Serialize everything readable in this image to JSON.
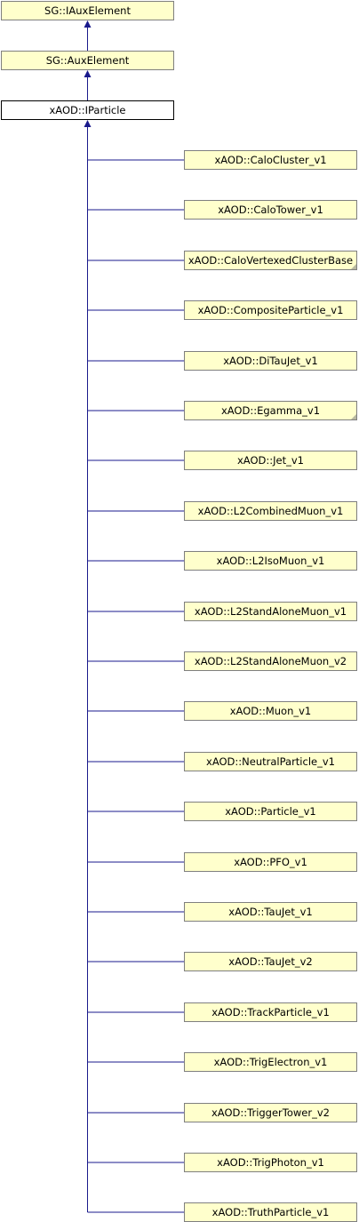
{
  "diagram": {
    "base_chain": [
      {
        "label": "SG::IAuxElement",
        "current": false
      },
      {
        "label": "SG::AuxElement",
        "current": false
      },
      {
        "label": "xAOD::IParticle",
        "current": true
      }
    ],
    "derived": [
      {
        "label": "xAOD::CaloCluster_v1",
        "folded": false
      },
      {
        "label": "xAOD::CaloTower_v1",
        "folded": false
      },
      {
        "label": "xAOD::CaloVertexedClusterBase",
        "folded": true
      },
      {
        "label": "xAOD::CompositeParticle_v1",
        "folded": false
      },
      {
        "label": "xAOD::DiTauJet_v1",
        "folded": false
      },
      {
        "label": "xAOD::Egamma_v1",
        "folded": true
      },
      {
        "label": "xAOD::Jet_v1",
        "folded": false
      },
      {
        "label": "xAOD::L2CombinedMuon_v1",
        "folded": false
      },
      {
        "label": "xAOD::L2IsoMuon_v1",
        "folded": false
      },
      {
        "label": "xAOD::L2StandAloneMuon_v1",
        "folded": false
      },
      {
        "label": "xAOD::L2StandAloneMuon_v2",
        "folded": false
      },
      {
        "label": "xAOD::Muon_v1",
        "folded": false
      },
      {
        "label": "xAOD::NeutralParticle_v1",
        "folded": false
      },
      {
        "label": "xAOD::Particle_v1",
        "folded": false
      },
      {
        "label": "xAOD::PFO_v1",
        "folded": false
      },
      {
        "label": "xAOD::TauJet_v1",
        "folded": false
      },
      {
        "label": "xAOD::TauJet_v2",
        "folded": false
      },
      {
        "label": "xAOD::TrackParticle_v1",
        "folded": false
      },
      {
        "label": "xAOD::TrigElectron_v1",
        "folded": false
      },
      {
        "label": "xAOD::TriggerTower_v2",
        "folded": false
      },
      {
        "label": "xAOD::TrigPhoton_v1",
        "folded": false
      },
      {
        "label": "xAOD::TruthParticle_v1",
        "folded": false
      }
    ],
    "colors": {
      "edge": "#1a1a8c",
      "node_fill": "#ffffcc",
      "node_border": "#7f7f7f"
    }
  }
}
